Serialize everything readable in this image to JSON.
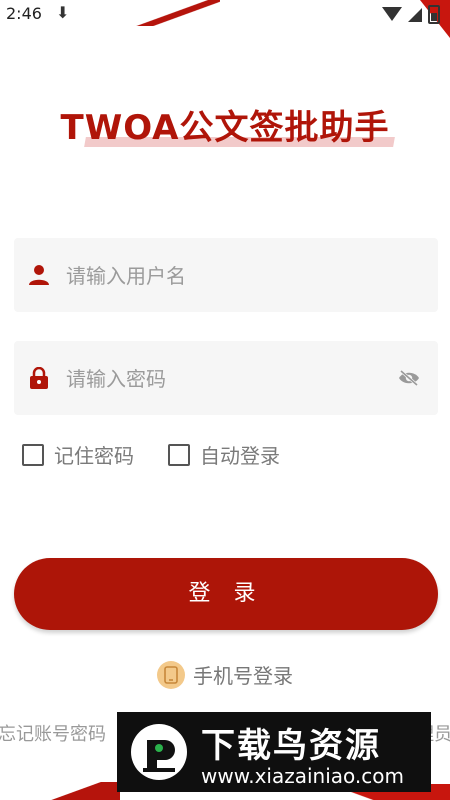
{
  "status_bar": {
    "time": "2:46",
    "download_glyph": "⬇"
  },
  "app": {
    "title": "TWOA公文签批助手"
  },
  "form": {
    "username_placeholder": "请输入用户名",
    "password_placeholder": "请输入密码",
    "remember_password_label": "记住密码",
    "auto_login_label": "自动登录",
    "login_button_label": "登 录",
    "phone_login_label": "手机号登录"
  },
  "footer": {
    "forgot_text": "忘记账号密码",
    "right_text": "理员"
  },
  "watermark": {
    "title": "下载鸟资源",
    "url": "www.xiazainiao.com"
  },
  "colors": {
    "accent": "#ad1508",
    "title": "#b01509",
    "field_bg": "#f6f6f6",
    "phone_icon_bg": "#f3c98a"
  },
  "icons": {
    "username": "user-icon",
    "password": "lock-icon",
    "visibility": "eye-off-icon",
    "phone": "phone-icon"
  }
}
